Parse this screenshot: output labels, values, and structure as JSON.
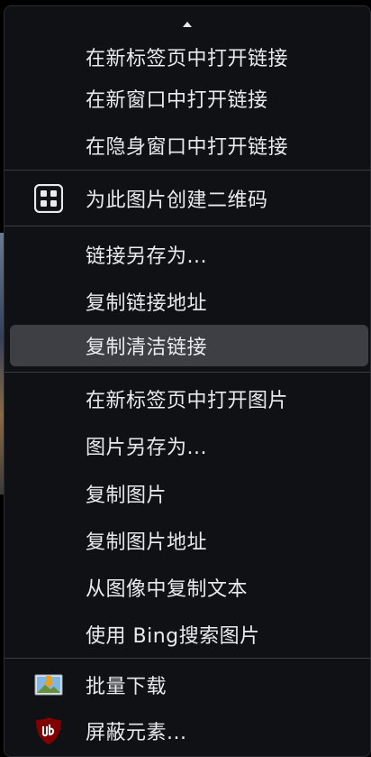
{
  "menu": {
    "items": [
      {
        "label": "在新标签页中打开链接"
      },
      {
        "label": "在新窗口中打开链接"
      },
      {
        "label": "在隐身窗口中打开链接"
      },
      {
        "label": "为此图片创建二维码",
        "icon": "qr-code-icon"
      },
      {
        "label": "链接另存为..."
      },
      {
        "label": "复制链接地址"
      },
      {
        "label": "复制清洁链接"
      },
      {
        "label": "在新标签页中打开图片"
      },
      {
        "label": "图片另存为..."
      },
      {
        "label": "复制图片"
      },
      {
        "label": "复制图片地址"
      },
      {
        "label": "从图像中复制文本"
      },
      {
        "label": "使用 Bing搜索图片"
      },
      {
        "label": "批量下载",
        "icon": "image-download-icon"
      },
      {
        "label": "屏蔽元素...",
        "icon": "ublock-shield-icon"
      }
    ]
  },
  "colors": {
    "background": "#0f1115",
    "text": "#e9eaee",
    "highlight": "#3d3f45",
    "separator": "#3a3c42",
    "ublock_red": "#800000"
  }
}
